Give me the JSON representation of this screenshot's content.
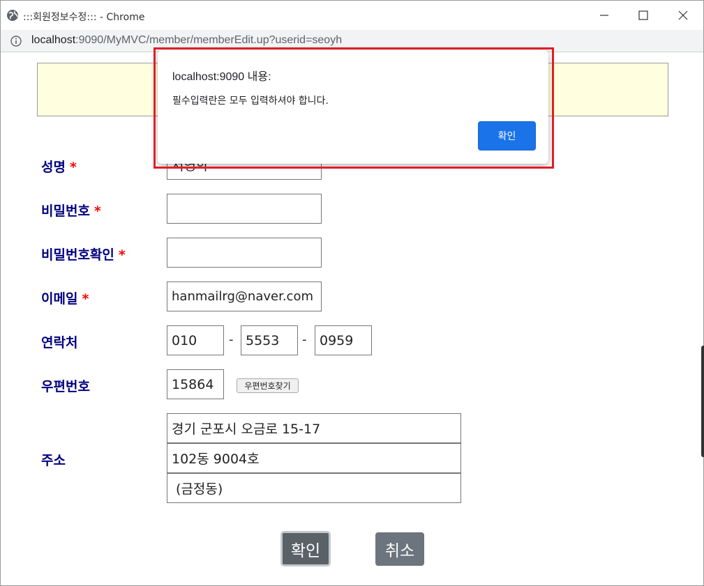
{
  "window": {
    "title": ":::회원정보수정::: - Chrome",
    "url_host": "localhost",
    "url_path": ":9090/MyMVC/member/memberEdit.up?userid=seoyh"
  },
  "form": {
    "name": {
      "label": "성명",
      "required": "*",
      "value": "서영학"
    },
    "password": {
      "label": "비밀번호",
      "required": "*",
      "value": ""
    },
    "password_confirm": {
      "label": "비밀번호확인",
      "required": "*",
      "value": ""
    },
    "email": {
      "label": "이메일",
      "required": "*",
      "value": "hanmailrg@naver.com"
    },
    "phone": {
      "label": "연락처",
      "part1": "010",
      "part2": "5553",
      "part3": "0959",
      "separator": "-"
    },
    "postcode": {
      "label": "우편번호",
      "value": "15864",
      "search_button": "우편번호찾기"
    },
    "address": {
      "label": "주소",
      "line1": "경기 군포시 오금로 15-17",
      "line2": "102동 9004호",
      "line3": " (금정동)"
    }
  },
  "buttons": {
    "ok": "확인",
    "cancel": "취소"
  },
  "dialog": {
    "title": "localhost:9090 내용:",
    "message": "필수입력란은 모두 입력하셔야 합니다.",
    "ok": "확인"
  },
  "colors": {
    "label": "#000080",
    "required": "#ff0000",
    "dialog_button": "#1a73e8",
    "highlight": "#e01e25",
    "banner": "#ffffe0"
  }
}
